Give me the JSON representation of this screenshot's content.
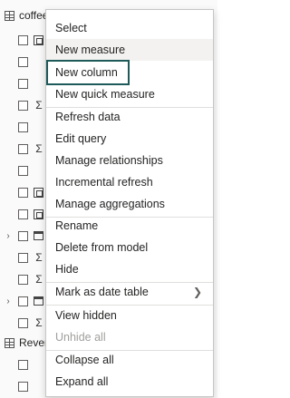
{
  "field_list": {
    "table1_label": "coffee_shop_sales",
    "table2_label": "Revenue"
  },
  "menu": {
    "select": "Select",
    "new_measure": "New measure",
    "new_column": "New column",
    "new_quick_measure": "New quick measure",
    "refresh_data": "Refresh data",
    "edit_query": "Edit query",
    "manage_relationships": "Manage relationships",
    "incremental_refresh": "Incremental refresh",
    "manage_aggregations": "Manage aggregations",
    "rename": "Rename",
    "delete_from_model": "Delete from model",
    "hide": "Hide",
    "mark_as_date_table": "Mark as date table",
    "view_hidden": "View hidden",
    "unhide_all": "Unhide all",
    "collapse_all": "Collapse all",
    "expand_all": "Expand all"
  },
  "icons": {
    "submenu": "chevron-right-icon",
    "sum": "Σ",
    "expand": "›"
  },
  "colors": {
    "focus_border": "#1f5a5a",
    "disabled_text": "#a19f9d"
  }
}
